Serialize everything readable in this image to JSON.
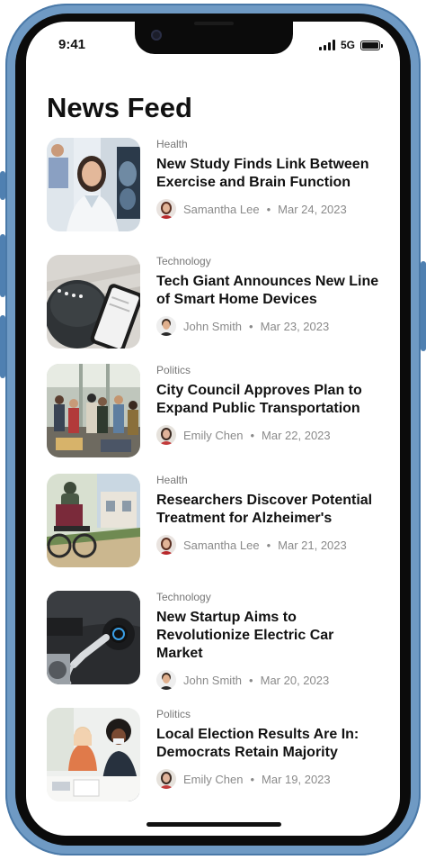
{
  "status_bar": {
    "time": "9:41",
    "network": "5G"
  },
  "page": {
    "title": "News Feed"
  },
  "articles": [
    {
      "category": "Health",
      "headline": "New Study Finds Link Between Exercise and Brain Function",
      "author": "Samantha Lee",
      "date": "Mar 24, 2023",
      "image": "doctor-with-brain-scan-photo"
    },
    {
      "category": "Technology",
      "headline": "Tech Giant Announces New Line of Smart Home Devices",
      "author": "John Smith",
      "date": "Mar 23, 2023",
      "image": "smart-speaker-and-phone-photo"
    },
    {
      "category": "Politics",
      "headline": "City Council Approves Plan to Expand Public Transportation",
      "author": "Emily Chen",
      "date": "Mar 22, 2023",
      "image": "crowded-subway-car-photo"
    },
    {
      "category": "Health",
      "headline": "Researchers Discover Potential Treatment for Alzheimer's",
      "author": "Samantha Lee",
      "date": "Mar 21, 2023",
      "image": "person-in-wheelchair-photo"
    },
    {
      "category": "Technology",
      "headline": "New Startup Aims to Revolutionize Electric Car Market",
      "author": "John Smith",
      "date": "Mar 20, 2023",
      "image": "electric-car-charging-photo"
    },
    {
      "category": "Politics",
      "headline": "Local Election Results Are In: Democrats Retain Majority",
      "author": "Emily Chen",
      "date": "Mar 19, 2023",
      "image": "people-at-polling-table-photo"
    }
  ]
}
